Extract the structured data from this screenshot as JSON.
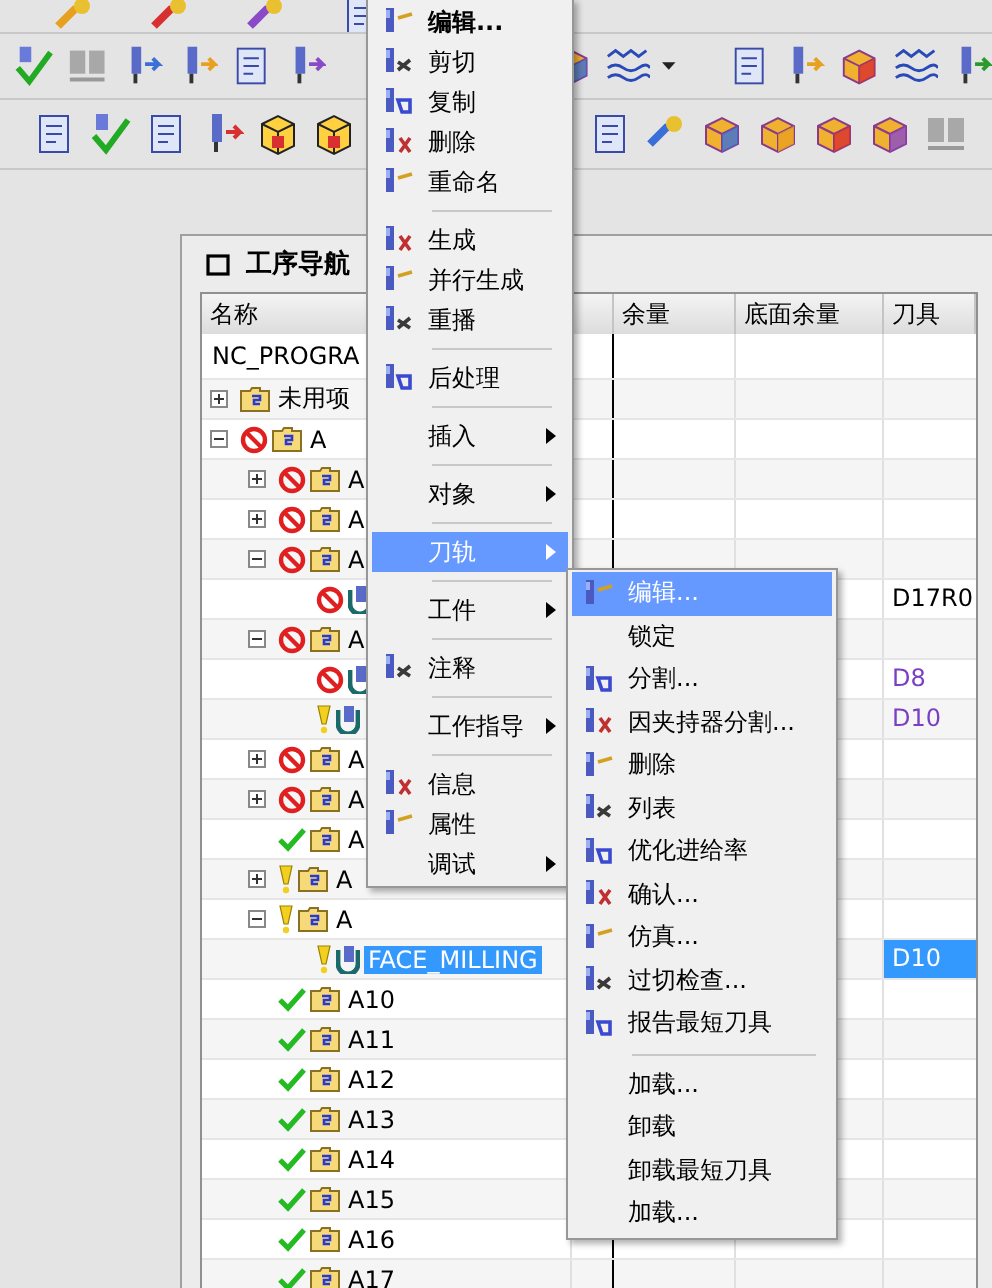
{
  "navigator": {
    "title": "工序导航",
    "columns": [
      "名称",
      "余量",
      "底面余量",
      "刀具"
    ],
    "root": "NC_PROGRA",
    "items": [
      {
        "name": "未用项",
        "kind": "group",
        "error": false,
        "warning": false,
        "complete": false,
        "expandable": true,
        "expanded": false,
        "selected": false
      },
      {
        "name": "A",
        "kind": "group",
        "error": true,
        "warning": false,
        "complete": false,
        "expandable": true,
        "expanded": true,
        "selected": false,
        "children": [
          {
            "name": "A",
            "kind": "group",
            "error": true,
            "warning": false,
            "complete": false,
            "expandable": true,
            "expanded": false,
            "selected": false
          },
          {
            "name": "A",
            "kind": "group",
            "error": true,
            "warning": false,
            "complete": false,
            "expandable": true,
            "expanded": false,
            "selected": false
          },
          {
            "name": "A",
            "kind": "group",
            "error": true,
            "warning": false,
            "complete": false,
            "expandable": true,
            "expanded": true,
            "selected": false,
            "children": [
              {
                "kind": "operation",
                "error": true,
                "warning": false,
                "complete": false,
                "expandable": false,
                "selected": false,
                "tool": "D17R0",
                "color": "#000000"
              }
            ]
          },
          {
            "name": "A",
            "kind": "group",
            "error": true,
            "warning": false,
            "complete": false,
            "expandable": true,
            "expanded": true,
            "selected": false,
            "children": [
              {
                "kind": "operation",
                "error": true,
                "warning": false,
                "complete": false,
                "expandable": false,
                "selected": false,
                "tool": "D8",
                "color": "#7b3fc4"
              },
              {
                "kind": "operation",
                "error": false,
                "warning": true,
                "complete": false,
                "expandable": false,
                "selected": false,
                "tool": "D10",
                "color": "#7b3fc4"
              }
            ]
          },
          {
            "name": "A",
            "kind": "group",
            "error": true,
            "warning": false,
            "complete": false,
            "expandable": true,
            "expanded": false,
            "selected": false
          },
          {
            "name": "A",
            "kind": "group",
            "error": true,
            "warning": false,
            "complete": false,
            "expandable": true,
            "expanded": false,
            "selected": false
          },
          {
            "name": "A",
            "kind": "group",
            "error": false,
            "warning": false,
            "complete": true,
            "expandable": false,
            "selected": false
          },
          {
            "name": "A",
            "kind": "group",
            "error": false,
            "warning": true,
            "complete": false,
            "expandable": true,
            "expanded": false,
            "selected": false
          },
          {
            "name": "A",
            "kind": "group",
            "error": false,
            "warning": true,
            "complete": false,
            "expandable": true,
            "expanded": true,
            "selected": false,
            "children": [
              {
                "name": "FACE_MILLING",
                "kind": "operation",
                "error": false,
                "warning": true,
                "complete": false,
                "expandable": false,
                "selected": true,
                "tool": "D10"
              }
            ]
          },
          {
            "name": "A10",
            "kind": "group",
            "error": false,
            "warning": false,
            "complete": true,
            "expandable": false,
            "selected": false
          },
          {
            "name": "A11",
            "kind": "group",
            "error": false,
            "warning": false,
            "complete": true,
            "expandable": false,
            "selected": false
          },
          {
            "name": "A12",
            "kind": "group",
            "error": false,
            "warning": false,
            "complete": true,
            "expandable": false,
            "selected": false
          },
          {
            "name": "A13",
            "kind": "group",
            "error": false,
            "warning": false,
            "complete": true,
            "expandable": false,
            "selected": false
          },
          {
            "name": "A14",
            "kind": "group",
            "error": false,
            "warning": false,
            "complete": true,
            "expandable": false,
            "selected": false
          },
          {
            "name": "A15",
            "kind": "group",
            "error": false,
            "warning": false,
            "complete": true,
            "expandable": false,
            "selected": false
          },
          {
            "name": "A16",
            "kind": "group",
            "error": false,
            "warning": false,
            "complete": true,
            "expandable": false,
            "selected": false
          },
          {
            "name": "A17",
            "kind": "group",
            "error": false,
            "warning": false,
            "complete": true,
            "expandable": false,
            "selected": false
          }
        ]
      }
    ]
  },
  "context_menu": {
    "groups": [
      {
        "items": [
          {
            "label": "编辑...",
            "kind": "icon",
            "bold": true,
            "selected": false
          },
          {
            "label": "剪切",
            "kind": "icon",
            "selected": false
          },
          {
            "label": "复制",
            "kind": "icon",
            "selected": false
          },
          {
            "label": "删除",
            "kind": "icon",
            "selected": false
          },
          {
            "label": "重命名",
            "kind": "icon",
            "selected": false
          }
        ]
      },
      {
        "items": [
          {
            "label": "生成",
            "kind": "icon",
            "selected": false
          },
          {
            "label": "并行生成",
            "kind": "icon",
            "selected": false
          },
          {
            "label": "重播",
            "kind": "icon",
            "selected": false
          }
        ]
      },
      {
        "items": [
          {
            "label": "后处理",
            "kind": "icon",
            "selected": false
          }
        ]
      },
      {
        "items": [
          {
            "label": "插入",
            "kind": "plain",
            "submenu": true,
            "selected": false
          }
        ]
      },
      {
        "items": [
          {
            "label": "对象",
            "kind": "plain",
            "submenu": true,
            "selected": false
          }
        ]
      },
      {
        "items": [
          {
            "label": "刀轨",
            "kind": "plain",
            "submenu": true,
            "selected": true
          }
        ]
      },
      {
        "items": [
          {
            "label": "工件",
            "kind": "plain",
            "submenu": true,
            "selected": false
          }
        ]
      },
      {
        "items": [
          {
            "label": "注释",
            "kind": "icon",
            "selected": false
          }
        ]
      },
      {
        "items": [
          {
            "label": "工作指导",
            "kind": "plain",
            "submenu": true,
            "selected": false
          }
        ]
      },
      {
        "items": [
          {
            "label": "信息",
            "kind": "icon",
            "selected": false
          },
          {
            "label": "属性",
            "kind": "icon",
            "selected": false
          },
          {
            "label": "调试",
            "kind": "plain",
            "submenu": true,
            "selected": false
          }
        ]
      }
    ]
  },
  "submenu": {
    "groups": [
      {
        "items": [
          {
            "label": "编辑...",
            "kind": "icon",
            "selected": true
          },
          {
            "label": "锁定",
            "kind": "plain",
            "selected": false
          },
          {
            "label": "分割...",
            "kind": "icon",
            "selected": false
          },
          {
            "label": "因夹持器分割...",
            "kind": "icon",
            "selected": false
          },
          {
            "label": "删除",
            "kind": "icon",
            "selected": false
          },
          {
            "label": "列表",
            "kind": "icon",
            "selected": false
          },
          {
            "label": "优化进给率",
            "kind": "icon",
            "selected": false
          },
          {
            "label": "确认...",
            "kind": "icon",
            "selected": false
          },
          {
            "label": "仿真...",
            "kind": "icon",
            "selected": false
          },
          {
            "label": "过切检查...",
            "kind": "icon",
            "selected": false
          },
          {
            "label": "报告最短刀具",
            "kind": "icon",
            "selected": false
          }
        ]
      },
      {
        "items": [
          {
            "label": "加载...",
            "kind": "plain",
            "selected": false
          },
          {
            "label": "卸载",
            "kind": "plain",
            "selected": false
          },
          {
            "label": "卸载",
            "trailing": "最短刀具",
            "kind": "plain",
            "selected": false
          },
          {
            "label": "加载...",
            "kind": "plain",
            "selected": false
          }
        ]
      }
    ]
  }
}
